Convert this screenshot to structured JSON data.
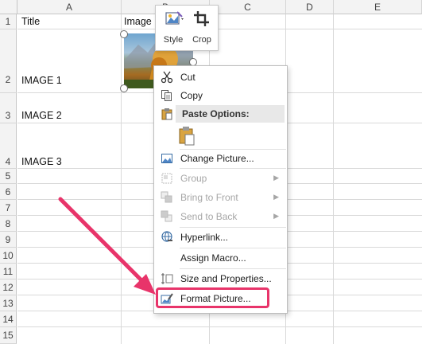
{
  "columns": [
    "A",
    "B",
    "C",
    "D",
    "E"
  ],
  "rows": [
    "1",
    "2",
    "3",
    "4",
    "5",
    "6",
    "7",
    "8",
    "9",
    "10",
    "11",
    "12",
    "13",
    "14",
    "15"
  ],
  "cells": {
    "a1": "Title",
    "b1": "Image",
    "a2": "IMAGE 1",
    "a3": "IMAGE 2",
    "a4": "IMAGE 3"
  },
  "mini_toolbar": {
    "style_label": "Style",
    "crop_label": "Crop"
  },
  "context_menu": {
    "cut": "Cut",
    "copy": "Copy",
    "paste_options": "Paste Options:",
    "change_picture": "Change Picture...",
    "group": "Group",
    "bring_to_front": "Bring to Front",
    "send_to_back": "Send to Back",
    "hyperlink": "Hyperlink...",
    "assign_macro": "Assign Macro...",
    "size_and_properties": "Size and Properties...",
    "format_picture": "Format Picture..."
  },
  "highlight_color": "#e8346a"
}
